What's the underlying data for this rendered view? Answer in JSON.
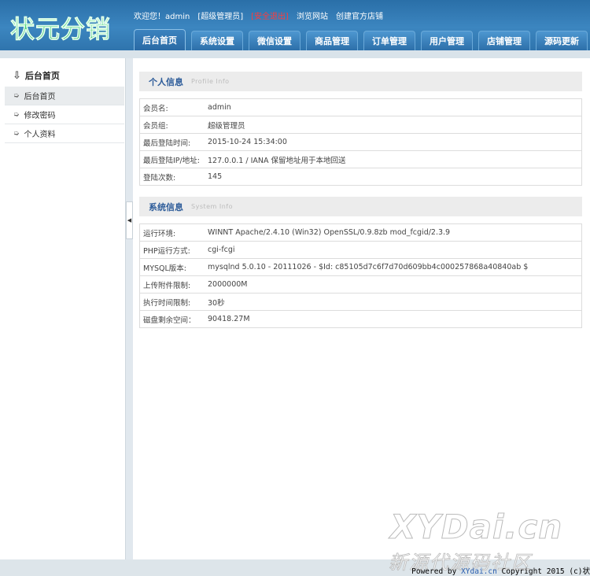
{
  "header": {
    "logo": "状元分销",
    "welcome": "欢迎您！admin",
    "role": "[超级管理员]",
    "logout": "[安全退出]",
    "browse_site": "浏览网站",
    "create_store": "创建官方店铺",
    "tabs": [
      "后台首页",
      "系统设置",
      "微信设置",
      "商品管理",
      "订单管理",
      "用户管理",
      "店铺管理",
      "源码更新"
    ]
  },
  "sidebar": {
    "title": "后台首页",
    "items": [
      "后台首页",
      "修改密码",
      "个人资料"
    ]
  },
  "profile": {
    "title": "个人信息",
    "subtitle": "Profile  Info",
    "rows": [
      {
        "k": "会员名:",
        "v": "admin"
      },
      {
        "k": "会员组:",
        "v": "超级管理员"
      },
      {
        "k": "最后登陆时间:",
        "v": "2015-10-24 15:34:00"
      },
      {
        "k": "最后登陆IP/地址:",
        "v": "127.0.0.1 / IANA 保留地址用于本地回送"
      },
      {
        "k": "登陆次数:",
        "v": "145"
      }
    ]
  },
  "system": {
    "title": "系统信息",
    "subtitle": "System  Info",
    "rows": [
      {
        "k": "运行环境:",
        "v": "WINNT Apache/2.4.10 (Win32) OpenSSL/0.9.8zb mod_fcgid/2.3.9"
      },
      {
        "k": "PHP运行方式:",
        "v": "cgi-fcgi"
      },
      {
        "k": "MYSQL版本:",
        "v": "mysqlnd 5.0.10 - 20111026 - $Id: c85105d7c6f7d70d609bb4c000257868a40840ab $"
      },
      {
        "k": "上传附件限制:",
        "v": "2000000M"
      },
      {
        "k": "执行时间限制:",
        "v": "30秒"
      },
      {
        "k": "磁盘剩余空间：",
        "v": "90418.27M"
      }
    ]
  },
  "footer": {
    "powered_prefix": "Powered by ",
    "powered_brand": "XYdai.cn",
    "powered_suffix": " Copyright 2015 (c)状"
  },
  "watermark": {
    "main": "XYDai.cn",
    "sub": "新源代源码社区"
  },
  "icons": {
    "sidebar_title": "arrow-down-outline-icon",
    "sidebar_item": "arrow-right-icon",
    "collapse": "triangle-left-icon"
  }
}
